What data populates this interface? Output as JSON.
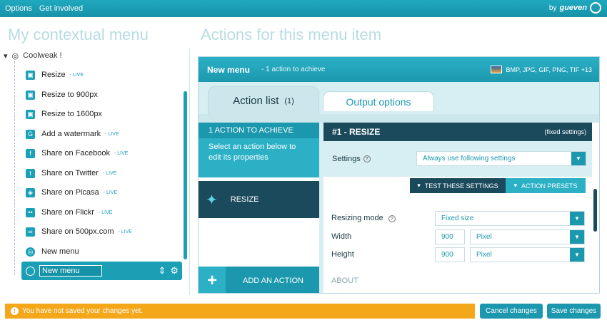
{
  "topbar": {
    "menu": [
      "Options",
      "Get involved"
    ],
    "brand_by": "by",
    "brand_name": "gueven"
  },
  "left": {
    "heading": "My contextual menu",
    "root_label": "Coolweak !",
    "items": [
      {
        "label": "Resize",
        "live": "- LIVE",
        "icon": "resize-icon"
      },
      {
        "label": "Resize to 900px",
        "live": "",
        "icon": "resize-icon"
      },
      {
        "label": "Resize to 1600px",
        "live": "",
        "icon": "resize-icon"
      },
      {
        "label": "Add a watermark",
        "live": "- LIVE",
        "icon": "watermark-icon"
      },
      {
        "label": "Share on Facebook",
        "live": "- LIVE",
        "icon": "facebook-icon"
      },
      {
        "label": "Share on Twitter",
        "live": "- LIVE",
        "icon": "twitter-icon"
      },
      {
        "label": "Share on Picasa",
        "live": "- LIVE",
        "icon": "picasa-icon"
      },
      {
        "label": "Share on Flickr",
        "live": "- LIVE",
        "icon": "flickr-icon"
      },
      {
        "label": "Share on 500px.com",
        "live": "- LIVE",
        "icon": "500px-icon"
      },
      {
        "label": "New menu",
        "live": "",
        "icon": "menu-icon"
      }
    ],
    "selected_value": "New menu"
  },
  "right": {
    "heading": "Actions for this menu item",
    "panel_title": "New menu",
    "panel_sub": "-   1 action to achieve",
    "formats": "BMP, JPG, GIF, PNG, TIF +13",
    "tabs": {
      "active": "Action list",
      "active_count": "(1)",
      "inactive": "Output options"
    },
    "achieve_head": "1 ACTION TO ACHIEVE",
    "achieve_body": "Select an action below to edit its properties",
    "action_card": "RESIZE",
    "add_action": "ADD AN ACTION",
    "detail": {
      "title": "#1 - RESIZE",
      "fixed": "(fixed settings)",
      "settings_label": "Settings",
      "settings_value": "Always use following settings",
      "test_btn": "TEST THESE SETTINGS",
      "preset_btn": "ACTION PRESETS",
      "mode_label": "Resizing mode",
      "mode_value": "Fixed size",
      "width_label": "Width",
      "width_value": "900",
      "width_unit": "Pixel",
      "height_label": "Height",
      "height_value": "900",
      "height_unit": "Pixel",
      "about": "ABOUT"
    }
  },
  "bottom": {
    "warning": "You have not saved your changes yet.",
    "cancel": "Cancel changes",
    "save": "Save changes"
  },
  "colors": {
    "accent": "#1b98ae",
    "dark": "#1b4a5c",
    "warning": "#f5a71a"
  }
}
